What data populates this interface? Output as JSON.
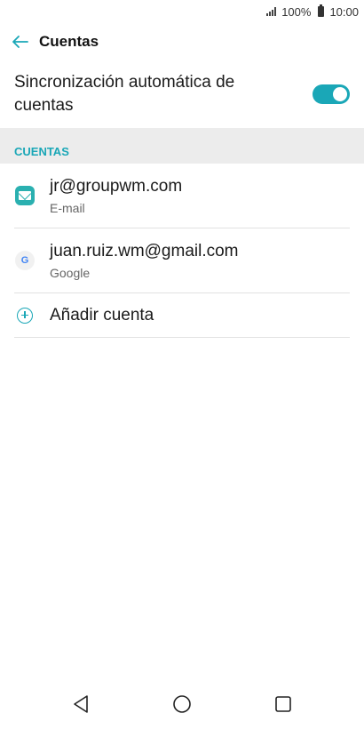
{
  "status_bar": {
    "battery": "100%",
    "time": "10:00"
  },
  "app_bar": {
    "title": "Cuentas"
  },
  "sync": {
    "label": "Sincronización automática de cuentas",
    "enabled": true
  },
  "section": {
    "title": "CUENTAS"
  },
  "accounts": [
    {
      "name": "jr@groupwm.com",
      "type": "E-mail",
      "icon": "email-icon"
    },
    {
      "name": "juan.ruiz.wm@gmail.com",
      "type": "Google",
      "icon": "google-icon",
      "icon_glyph": "G"
    }
  ],
  "add_account": {
    "label": "Añadir cuenta",
    "icon": "add-icon"
  },
  "colors": {
    "accent": "#1aa7b7",
    "section_bg": "#ececec",
    "email_icon": "#2ab0b0"
  },
  "nav": {
    "back": "back-nav-icon",
    "home": "home-nav-icon",
    "recents": "recents-nav-icon"
  }
}
